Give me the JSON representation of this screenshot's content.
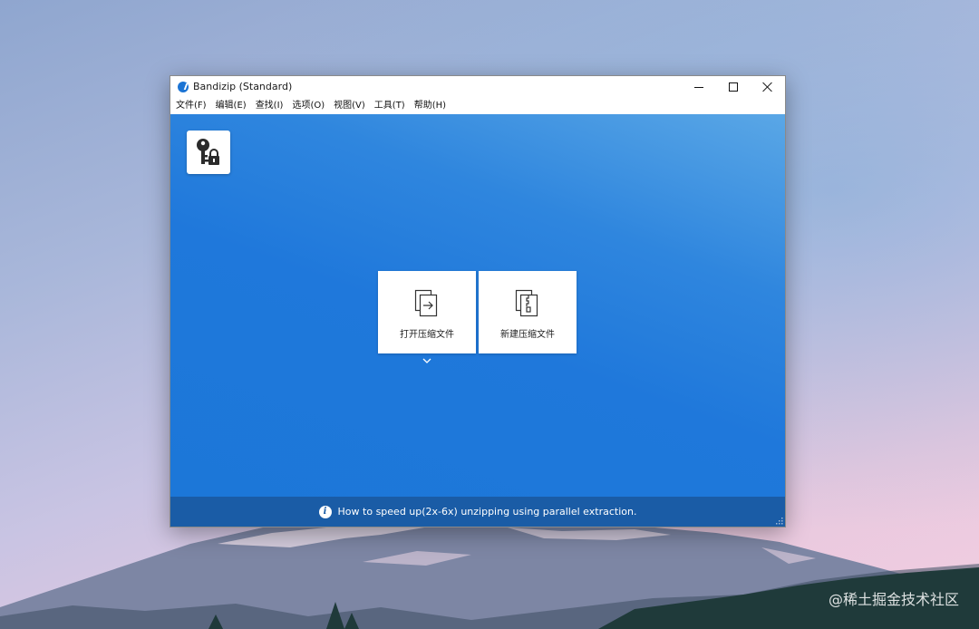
{
  "window": {
    "title": "Bandizip (Standard)"
  },
  "menu": {
    "items": [
      {
        "label": "文件(F)"
      },
      {
        "label": "编辑(E)"
      },
      {
        "label": "查找(I)"
      },
      {
        "label": "选项(O)"
      },
      {
        "label": "视图(V)"
      },
      {
        "label": "工具(T)"
      },
      {
        "label": "帮助(H)"
      }
    ]
  },
  "main": {
    "open_archive_label": "打开压缩文件",
    "new_archive_label": "新建压缩文件"
  },
  "status": {
    "text": "How to speed up(2x-6x) unzipping using parallel extraction."
  },
  "watermark": {
    "text": "@稀土掘金技术社区"
  },
  "icons": {
    "app": "bandizip-logo-icon",
    "key_lock": "key-lock-icon",
    "open_archive": "open-archive-icon",
    "new_archive": "zip-archive-icon",
    "info": "info-icon"
  },
  "colors": {
    "content_blue": "#1f78db",
    "status_bar": "#1a5ca6"
  }
}
